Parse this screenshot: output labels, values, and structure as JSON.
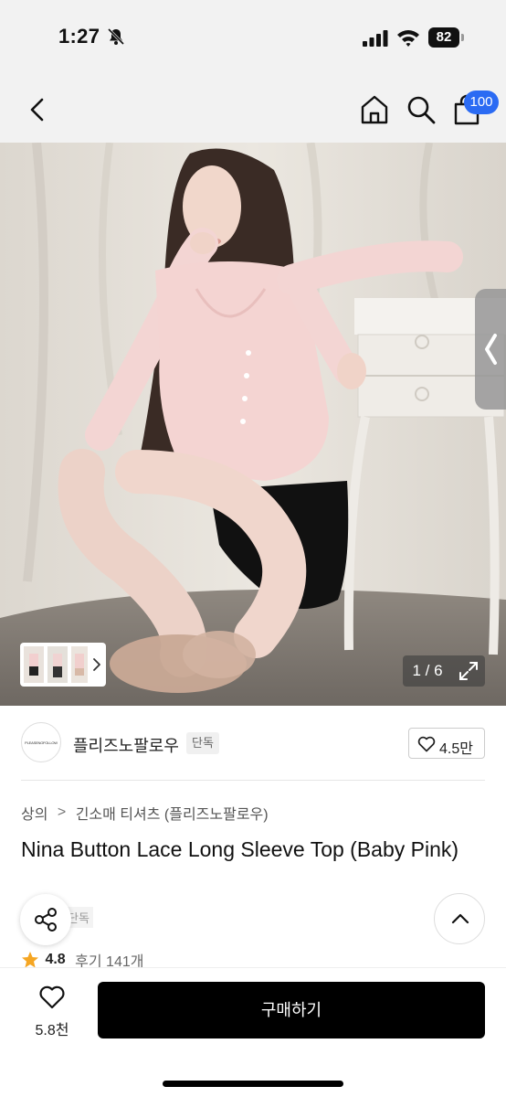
{
  "status_bar": {
    "time": "1:27",
    "battery": "82",
    "icons": [
      "bell-off-icon",
      "signal-icon",
      "wifi-icon",
      "battery-icon"
    ]
  },
  "header": {
    "icons": [
      "back-icon",
      "home-icon",
      "search-icon",
      "cart-icon"
    ],
    "cart_badge": "100"
  },
  "gallery": {
    "page_indicator": "1 / 6",
    "current_page": 1,
    "total_pages": 6,
    "icons": [
      "side-tab-chevron-icon",
      "thumb-next-icon",
      "expand-icon"
    ]
  },
  "brand": {
    "logo_text": "PLEASENOFOLLOW",
    "name": "플리즈노팔로우",
    "badge": "단독",
    "like_count": "4.5만"
  },
  "breadcrumb": {
    "items": [
      "상의",
      "긴소매 티셔츠 (플리즈노팔로우)"
    ],
    "separator": ">"
  },
  "product": {
    "title": "Nina Button Lace Long Sleeve Top (Baby Pink)",
    "sub_badge": "단독",
    "rating": "4.8",
    "review_label": "후기 141개"
  },
  "bottom_bar": {
    "wish_count": "5.8천",
    "buy_label": "구매하기"
  },
  "colors": {
    "accent_blue": "#2b6bf3",
    "star_orange": "#f5a623",
    "buy_button": "#000000"
  }
}
